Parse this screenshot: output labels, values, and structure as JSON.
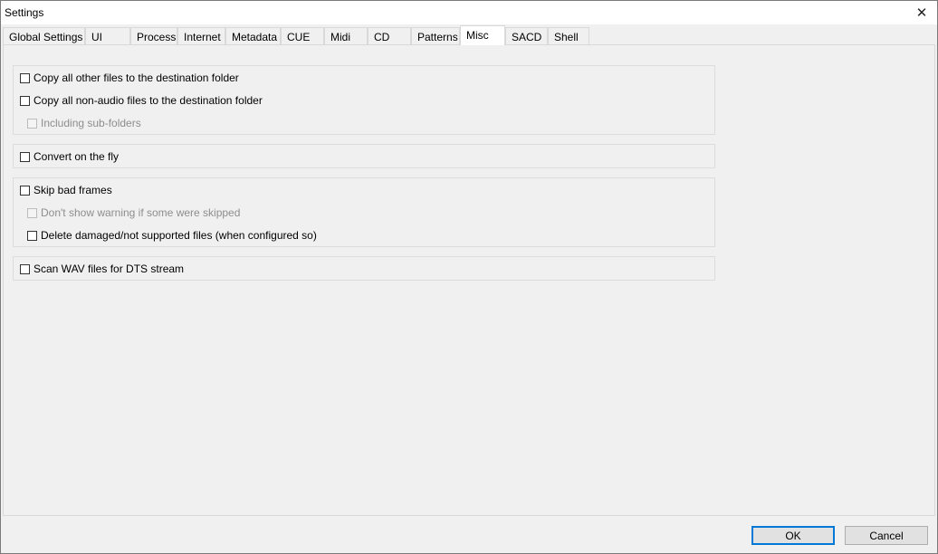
{
  "window": {
    "title": "Settings",
    "close_glyph": "✕"
  },
  "tabs": [
    {
      "label": "Global Settings"
    },
    {
      "label": "UI"
    },
    {
      "label": "Process"
    },
    {
      "label": "Internet"
    },
    {
      "label": "Metadata"
    },
    {
      "label": "CUE"
    },
    {
      "label": "Midi"
    },
    {
      "label": "CD"
    },
    {
      "label": "Patterns"
    },
    {
      "label": "Misc",
      "active": true
    },
    {
      "label": "SACD"
    },
    {
      "label": "Shell"
    }
  ],
  "misc": {
    "copy_other": {
      "label": "Copy all other files to the destination folder",
      "checked": false,
      "enabled": true
    },
    "copy_nonaudio": {
      "label": "Copy all non-audio files to the destination folder",
      "checked": false,
      "enabled": true
    },
    "include_subfolders": {
      "label": "Including sub-folders",
      "checked": false,
      "enabled": false
    },
    "convert_fly": {
      "label": "Convert on the fly",
      "checked": false,
      "enabled": true
    },
    "skip_bad": {
      "label": "Skip bad frames",
      "checked": false,
      "enabled": true
    },
    "no_warning": {
      "label": "Don't show warning if some were skipped",
      "checked": false,
      "enabled": false
    },
    "delete_damaged": {
      "label": "Delete damaged/not supported files (when configured so)",
      "checked": false,
      "enabled": true
    },
    "scan_wav": {
      "label": "Scan WAV files for DTS stream",
      "checked": false,
      "enabled": true
    }
  },
  "footer": {
    "ok_label": "OK",
    "cancel_label": "Cancel"
  }
}
